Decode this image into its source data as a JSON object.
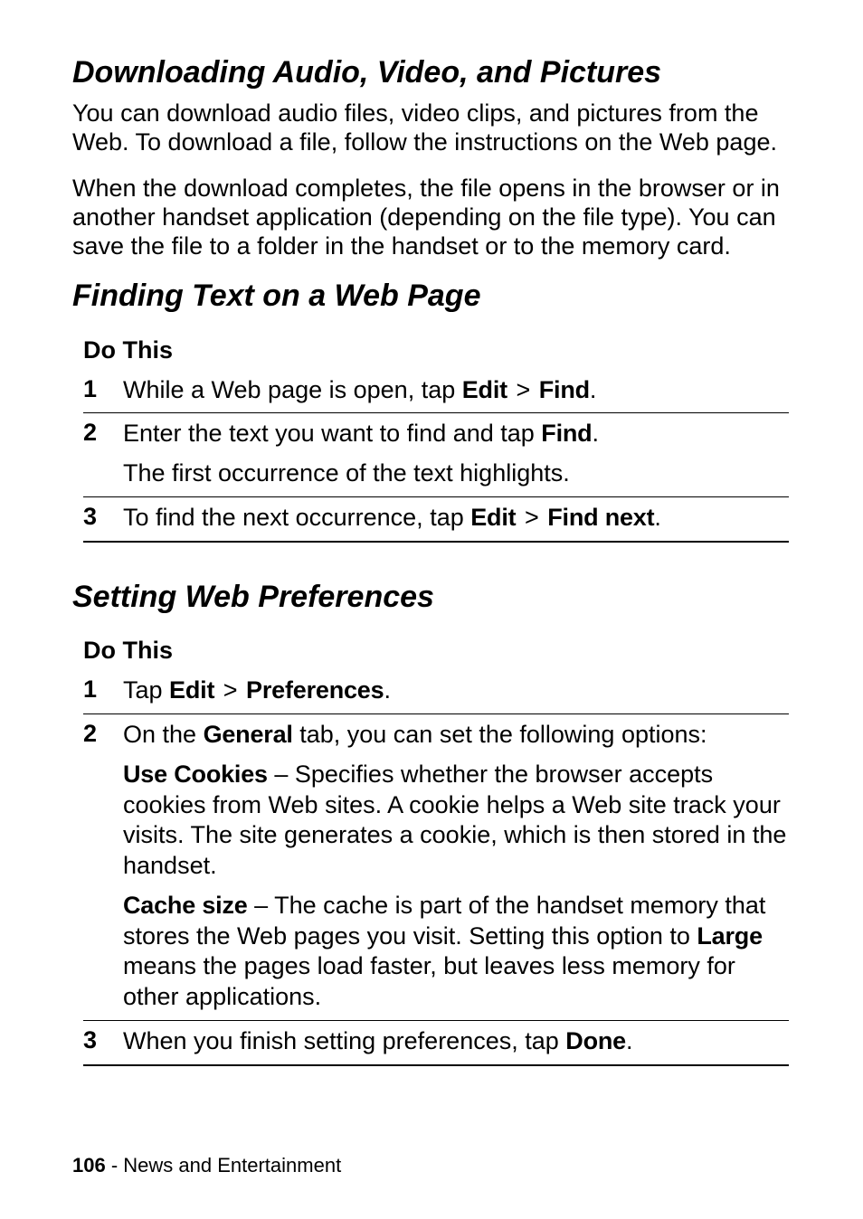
{
  "sections": {
    "s1": {
      "heading": "Downloading Audio, Video, and Pictures",
      "p1": "You can download audio files, video clips, and pictures from the Web. To download a file, follow the instructions on the Web page.",
      "p2": "When the download completes, the file opens in the browser or in another handset application (depending on the file type). You can save the file to a folder in the handset or to the memory card."
    },
    "s2": {
      "heading": "Finding Text on a Web Page",
      "do_this": "Do This",
      "steps": {
        "n1": "1",
        "n2": "2",
        "n3": "3",
        "r1a": "While a Web page is open, tap ",
        "r1_edit": "Edit",
        "r1_gt": " > ",
        "r1_find": "Find",
        "r1b": ".",
        "r2a": "Enter the text you want to find and tap ",
        "r2_find": "Find",
        "r2b": ".",
        "r2c": "The first occurrence of the text highlights.",
        "r3a": "To find the next occurrence, tap ",
        "r3_edit": "Edit",
        "r3_gt": " > ",
        "r3_findnext": "Find next",
        "r3b": "."
      }
    },
    "s3": {
      "heading": "Setting Web Preferences",
      "do_this": "Do This",
      "steps": {
        "n1": "1",
        "n2": "2",
        "n3": "3",
        "r1a": "Tap ",
        "r1_edit": "Edit",
        "r1_gt": " > ",
        "r1_prefs": "Preferences",
        "r1b": ".",
        "r2a": "On the ",
        "r2_general": "General",
        "r2b": " tab, you can set the following options:",
        "r2c_lead": "Use Cookies",
        "r2c_rest": " – Specifies whether the browser accepts cookies from Web sites. A cookie helps a Web site track your visits. The site generates a cookie, which is then stored in the handset.",
        "r2d_lead": "Cache size",
        "r2d_rest1": " – The cache is part of the handset memory that stores the Web pages you visit. Setting this option to ",
        "r2d_large": "Large",
        "r2d_rest2": " means the pages load faster, but leaves less memory for other applications.",
        "r3a": "When you finish setting preferences, tap ",
        "r3_done": "Done",
        "r3b": "."
      }
    }
  },
  "footer": {
    "page_number": "106",
    "separator": " - ",
    "section": "News and Entertainment"
  }
}
